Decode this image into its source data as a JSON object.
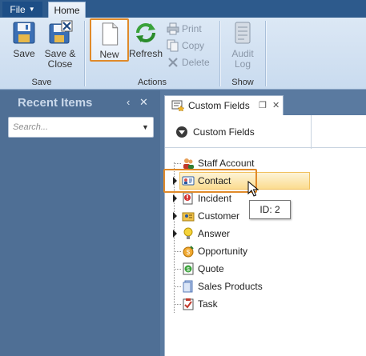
{
  "tabs": {
    "file_label": "File",
    "home_label": "Home"
  },
  "ribbon": {
    "groups": {
      "save": "Save",
      "actions": "Actions",
      "show": "Show"
    },
    "buttons": {
      "save": "Save",
      "save_close_line1": "Save &",
      "save_close_line2": "Close",
      "new": "New",
      "refresh": "Refresh",
      "print": "Print",
      "copy": "Copy",
      "delete": "Delete",
      "audit_log_line1": "Audit",
      "audit_log_line2": "Log"
    }
  },
  "recent_items": {
    "title": "Recent Items",
    "search_placeholder": "Search..."
  },
  "document_tab": {
    "title": "Custom Fields"
  },
  "content": {
    "header": "Custom Fields",
    "tree_items": [
      {
        "label": "Staff Account",
        "icon": "staff-icon",
        "expandable": false
      },
      {
        "label": "Contact",
        "icon": "contact-card-icon",
        "expandable": true,
        "selected": true
      },
      {
        "label": "Incident",
        "icon": "incident-icon",
        "expandable": true
      },
      {
        "label": "Customer",
        "icon": "customer-icon",
        "expandable": true
      },
      {
        "label": "Answer",
        "icon": "answer-bulb-icon",
        "expandable": true
      },
      {
        "label": "Opportunity",
        "icon": "opportunity-icon",
        "expandable": false
      },
      {
        "label": "Quote",
        "icon": "quote-icon",
        "expandable": false
      },
      {
        "label": "Sales Products",
        "icon": "sales-products-icon",
        "expandable": false
      },
      {
        "label": "Task",
        "icon": "task-icon",
        "expandable": false
      }
    ],
    "tooltip": "ID: 2"
  },
  "colors": {
    "accent_highlight": "#e08a2a",
    "ribbon_bg": "#dce8f5",
    "panel_bg": "#4f6f95",
    "selected_row": "#fbdc90"
  }
}
